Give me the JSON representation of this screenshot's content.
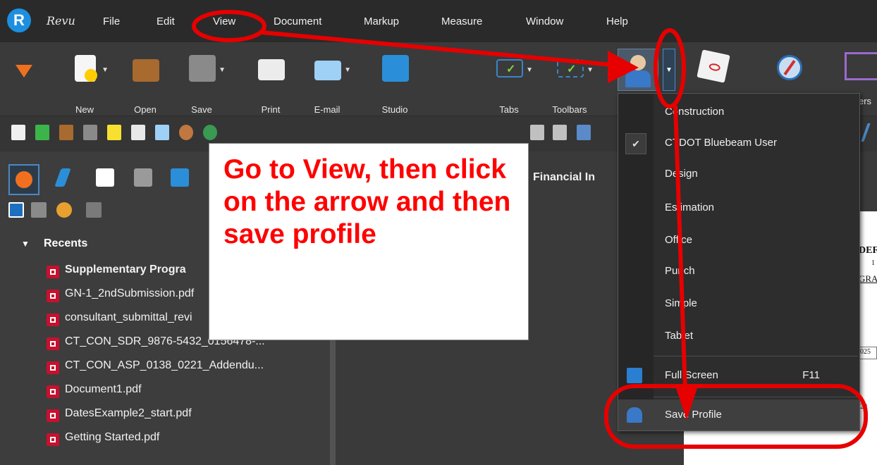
{
  "app": {
    "brand": "Revu",
    "logo_letter": "R"
  },
  "menu": [
    "File",
    "Edit",
    "View",
    "Document",
    "Markup",
    "Measure",
    "Window",
    "Help"
  ],
  "ribbon": {
    "new": "New",
    "open": "Open",
    "save": "Save",
    "print": "Print",
    "email": "E-mail",
    "studio": "Studio",
    "tabs": "Tabs",
    "toolbars": "Toolbars",
    "partial": "ers"
  },
  "panel": {
    "recents_header": "Recents",
    "files": [
      {
        "name": "Supplementary Progra",
        "bold": true
      },
      {
        "name": "GN-1_2ndSubmission.pdf",
        "bold": false
      },
      {
        "name": "consultant_submittal_revi",
        "bold": false
      },
      {
        "name": "CT_CON_SDR_9876-5432_0156478-...",
        "bold": false
      },
      {
        "name": "CT_CON_ASP_0138_0221_Addendu...",
        "bold": false
      },
      {
        "name": "Document1.pdf",
        "bold": false
      },
      {
        "name": "DatesExample2_start.pdf",
        "bold": false
      },
      {
        "name": "Getting Started.pdf",
        "bold": false
      }
    ]
  },
  "doc": {
    "tab_title": "Financial In",
    "page_fragments": [
      "DEF",
      "1",
      "GRA",
      "025",
      "20"
    ]
  },
  "dropdown": {
    "items": [
      {
        "label": "Construction",
        "checked": false
      },
      {
        "label": "CTDOT Bluebeam User",
        "checked": true
      },
      {
        "label": "Design",
        "checked": false
      },
      {
        "label": "Estimation",
        "checked": false
      },
      {
        "label": "Office",
        "checked": false
      },
      {
        "label": "Punch",
        "checked": false
      },
      {
        "label": "Simple",
        "checked": false
      },
      {
        "label": "Tablet",
        "checked": false
      }
    ],
    "fullscreen_label": "Full Screen",
    "fullscreen_shortcut": "F11",
    "save_profile_label": "Save Profile",
    "check_mark": "✔"
  },
  "callout": {
    "text": "Go to View, then click on the arrow and then save profile"
  },
  "colors": {
    "annotation": "#e60000",
    "callout_text": "#ff0000",
    "accent": "#4b88c4"
  }
}
